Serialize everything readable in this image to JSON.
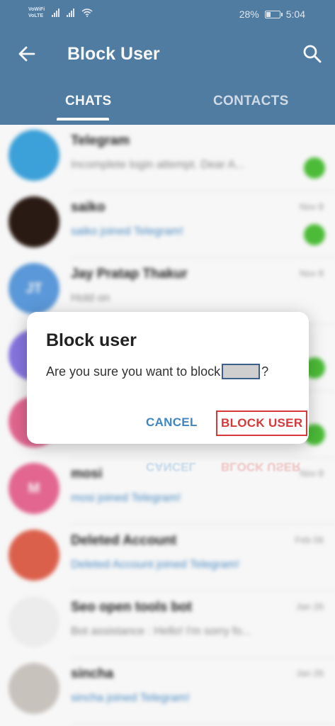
{
  "status_bar": {
    "net_tag_1": "VoWiFi",
    "net_tag_2": "VoLTE",
    "battery_percent": "28%",
    "time": "5:04"
  },
  "appbar": {
    "title": "Block User",
    "tabs": [
      {
        "label": "CHATS",
        "selected": true
      },
      {
        "label": "CONTACTS",
        "selected": false
      }
    ]
  },
  "chats": [
    {
      "name": "Telegram",
      "message": "Incomplete login attempt. Dear A...",
      "time": "",
      "avatar_text": "",
      "avatar_color": "#3ea6e0",
      "badge": true,
      "message_blue": false
    },
    {
      "name": "saiko",
      "message": "saiko joined Telegram!",
      "time": "Nov 8",
      "avatar_text": "",
      "avatar_color": "#2b1b14",
      "badge": true,
      "message_blue": true
    },
    {
      "name": "Jay Pratap Thakur",
      "message": "Hold on",
      "time": "Nov 8",
      "avatar_text": "JT",
      "avatar_color": "#5e9de0",
      "badge": false,
      "message_blue": false
    },
    {
      "name": "",
      "message": "",
      "time": "",
      "avatar_text": "",
      "avatar_color": "#8b78e6",
      "badge": true,
      "message_blue": false
    },
    {
      "name": "",
      "message": "",
      "time": "",
      "avatar_text": "",
      "avatar_color": "#ea6a94",
      "badge": true,
      "message_blue": false
    },
    {
      "name": "mosi",
      "message": "mosi joined Telegram!",
      "time": "Nov 8",
      "avatar_text": "M",
      "avatar_color": "#ea6a94",
      "badge": false,
      "message_blue": true
    },
    {
      "name": "Deleted Account",
      "message": "Deleted Account joined Telegram!",
      "time": "Feb 06",
      "avatar_text": "",
      "avatar_color": "#e3644f",
      "badge": false,
      "message_blue": true
    },
    {
      "name": "Seo open tools bot",
      "message": "Bot assistance : Hello! I'm sorry fo...",
      "time": "Jan 26",
      "avatar_text": "",
      "avatar_color": "#f4f4f4",
      "badge": false,
      "message_blue": false
    },
    {
      "name": "sincha",
      "message": "sincha joined Telegram!",
      "time": "Jan 26",
      "avatar_text": "",
      "avatar_color": "#cfc9c4",
      "badge": false,
      "message_blue": true
    }
  ],
  "dialog": {
    "title": "Block user",
    "message_prefix": "Are you sure you want to block",
    "message_suffix": "?",
    "cancel_label": "CANCEL",
    "block_label": "BLOCK USER"
  },
  "colors": {
    "primary": "#5380a8",
    "accent_blue": "#3f86c3",
    "destructive_red": "#d6393a",
    "badge_green": "#4fc23a"
  }
}
